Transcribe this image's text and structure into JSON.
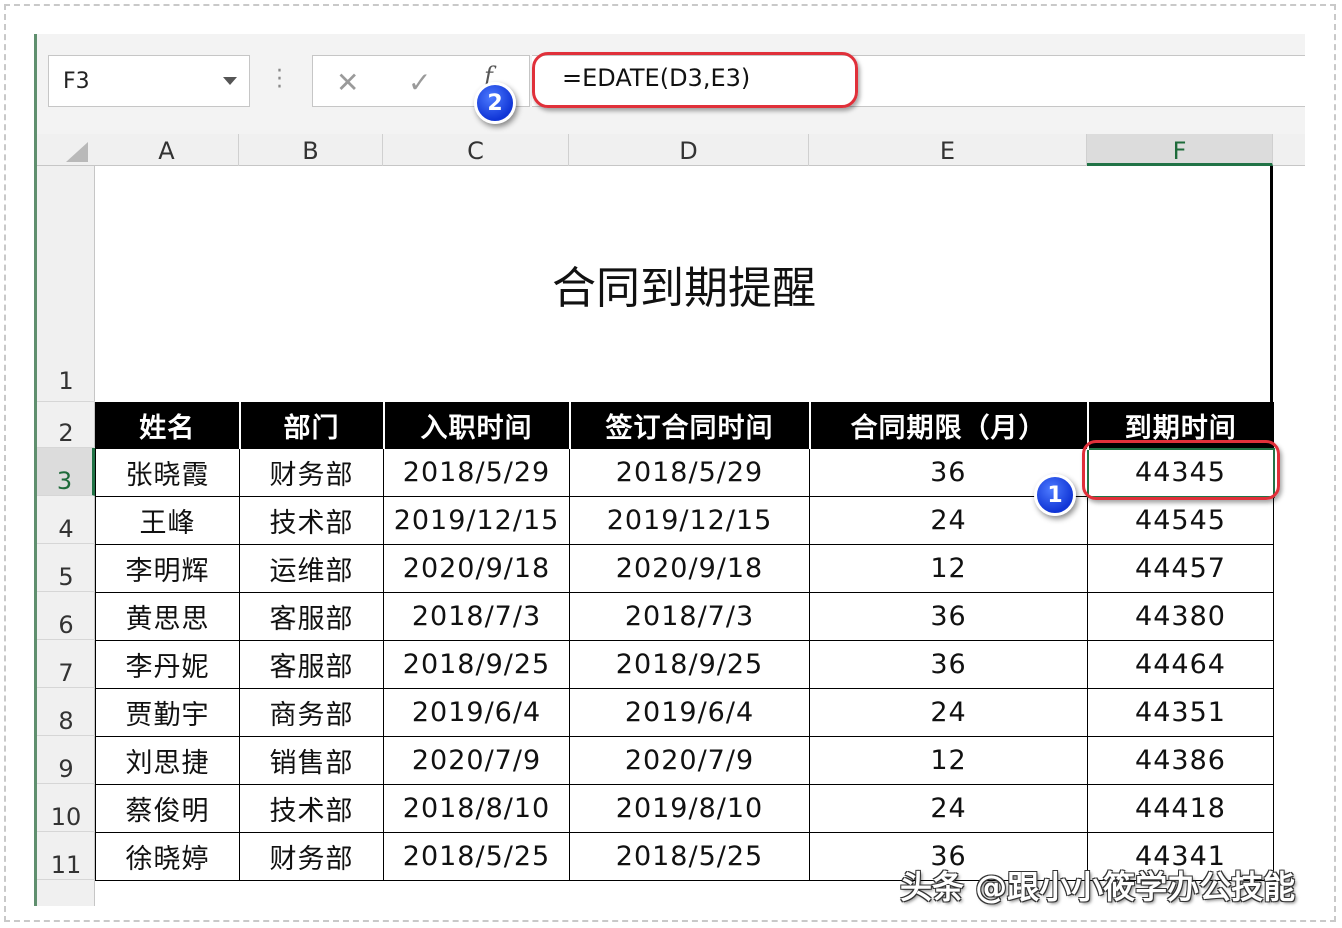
{
  "name_box": {
    "value": "F3"
  },
  "formula_bar": {
    "cancel_icon": "✕",
    "enter_icon": "✓",
    "fx_icon": "f",
    "formula": "=EDATE(D3,E3)"
  },
  "badges": [
    "1",
    "2"
  ],
  "columns": [
    "A",
    "B",
    "C",
    "D",
    "E",
    "F"
  ],
  "rows": [
    "1",
    "2",
    "3",
    "4",
    "5",
    "6",
    "7",
    "8",
    "9",
    "10",
    "11"
  ],
  "title": "合同到期提醒",
  "table": {
    "headers": [
      "姓名",
      "部门",
      "入职时间",
      "签订合同时间",
      "合同期限（月）",
      "到期时间"
    ],
    "rows": [
      [
        "张晓霞",
        "财务部",
        "2018/5/29",
        "2018/5/29",
        "36",
        "44345"
      ],
      [
        "王峰",
        "技术部",
        "2019/12/15",
        "2019/12/15",
        "24",
        "44545"
      ],
      [
        "李明辉",
        "运维部",
        "2020/9/18",
        "2020/9/18",
        "12",
        "44457"
      ],
      [
        "黄思思",
        "客服部",
        "2018/7/3",
        "2018/7/3",
        "36",
        "44380"
      ],
      [
        "李丹妮",
        "客服部",
        "2018/9/25",
        "2018/9/25",
        "36",
        "44464"
      ],
      [
        "贾勤宇",
        "商务部",
        "2019/6/4",
        "2019/6/4",
        "24",
        "44351"
      ],
      [
        "刘思捷",
        "销售部",
        "2020/7/9",
        "2020/7/9",
        "12",
        "44386"
      ],
      [
        "蔡俊明",
        "技术部",
        "2018/8/10",
        "2019/8/10",
        "24",
        "44418"
      ],
      [
        "徐晓婷",
        "财务部",
        "2018/5/25",
        "2018/5/25",
        "36",
        "44341"
      ]
    ]
  },
  "watermark": "头条 @跟小小筱学办公技能",
  "colors": {
    "selection": "#217346",
    "annotation": "#e0303a",
    "badge": "#1035d6"
  }
}
